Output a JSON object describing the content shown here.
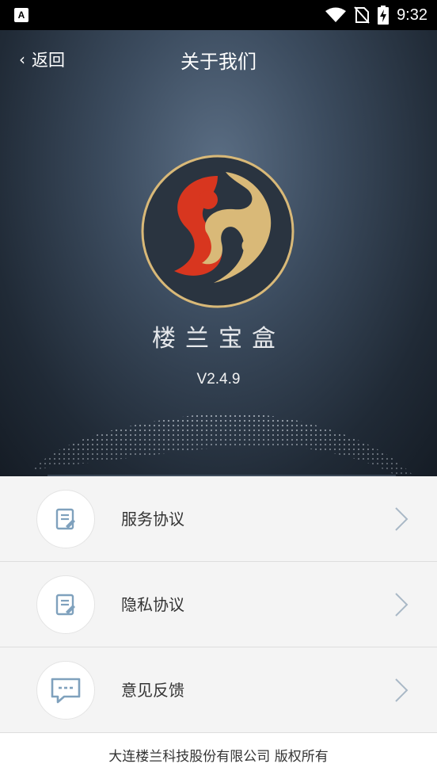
{
  "status_bar": {
    "time": "9:32",
    "left_icon_glyph": "A",
    "icons": [
      "wifi-icon",
      "no-sim-icon",
      "battery-charging-icon"
    ]
  },
  "header": {
    "back_label": "返回",
    "title": "关于我们"
  },
  "app": {
    "name": "楼兰宝盒",
    "version": "V2.4.9"
  },
  "menu": [
    {
      "label": "服务协议",
      "icon": "document-edit-icon"
    },
    {
      "label": "隐私协议",
      "icon": "document-edit-icon"
    },
    {
      "label": "意见反馈",
      "icon": "feedback-chat-icon"
    }
  ],
  "footer": {
    "copyright": "大连楼兰科技股份有限公司  版权所有"
  },
  "colors": {
    "icon_blue": "#7fa1bd",
    "logo_red": "#d8361f",
    "logo_gold": "#d9b978",
    "hero_dark": "#202a36"
  }
}
